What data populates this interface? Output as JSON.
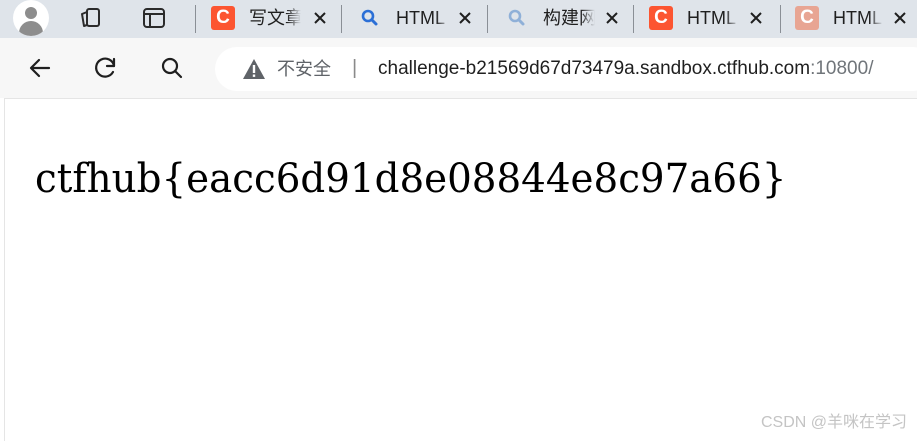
{
  "tabs": [
    {
      "title": "写文章",
      "favicon": "csdn-c-icon"
    },
    {
      "title": "HTML",
      "favicon": "search-icon"
    },
    {
      "title": "构建网",
      "favicon": "search-icon"
    },
    {
      "title": "HTML",
      "favicon": "csdn-c-icon"
    },
    {
      "title": "HTML",
      "favicon": "csdn-c-icon"
    }
  ],
  "address": {
    "security_label": "不安全",
    "separator": "|",
    "host": "challenge-b21569d67d73479a.sandbox.ctfhub.com",
    "port": ":10800/"
  },
  "page": {
    "flag_text": "ctfhub{eacc6d91d8e08844e8c97a66}",
    "watermark": "CSDN @羊咪在学习"
  },
  "colors": {
    "tabbar_bg": "#dfe4ea",
    "toolbar_bg": "#f7f7f7",
    "csdn_red": "#fc5531",
    "search_blue": "#2b6fd6"
  }
}
